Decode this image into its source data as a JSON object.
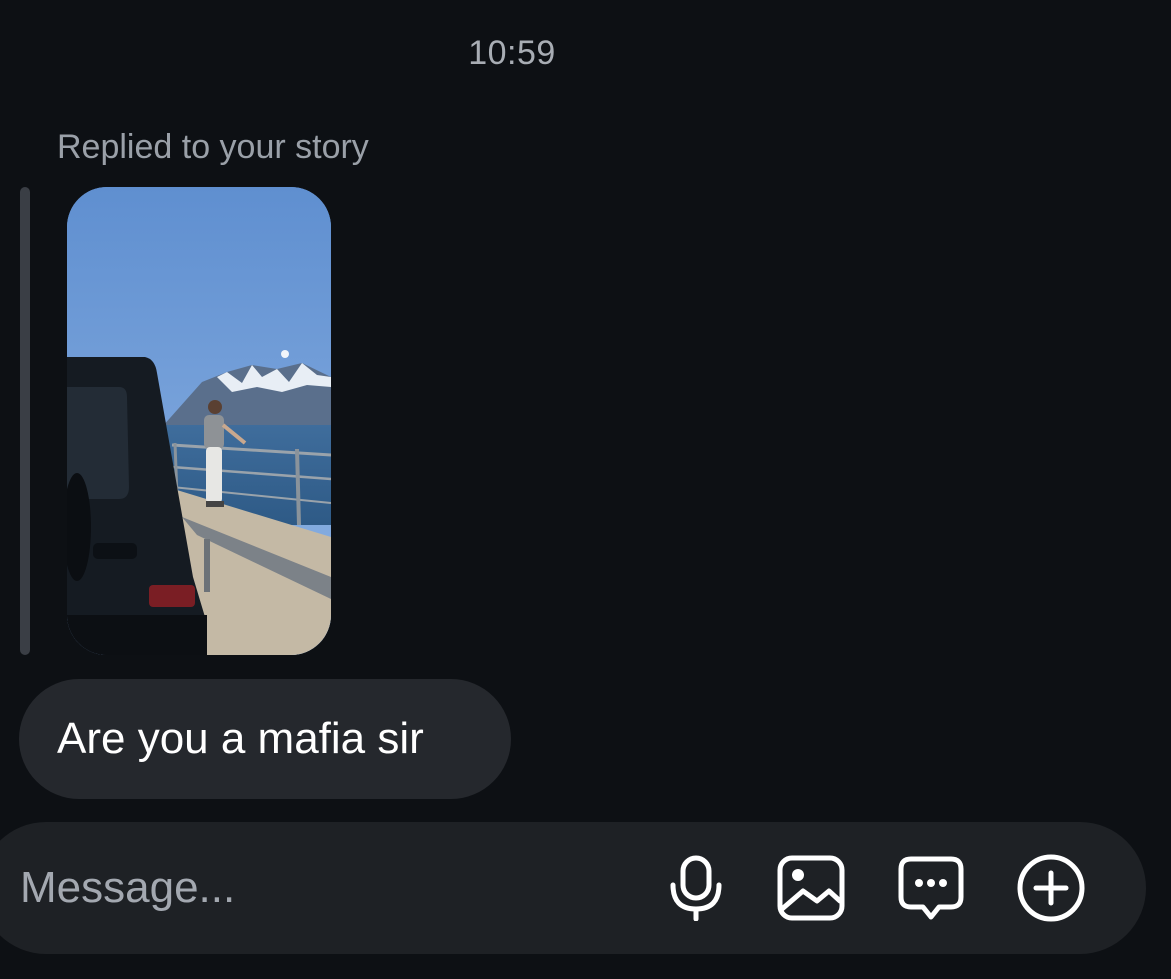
{
  "thread": {
    "timestamp": "10:59",
    "reply_label": "Replied to your story",
    "message_text": "Are you a mafia sir"
  },
  "composer": {
    "placeholder": "Message...",
    "icons": [
      "microphone-icon",
      "image-icon",
      "chat-bubble-icon",
      "plus-circle-icon"
    ]
  },
  "colors": {
    "background": "#0d1014",
    "bubble": "#25282d",
    "composer": "#1e2125",
    "muted_text": "#9aa0a8"
  }
}
